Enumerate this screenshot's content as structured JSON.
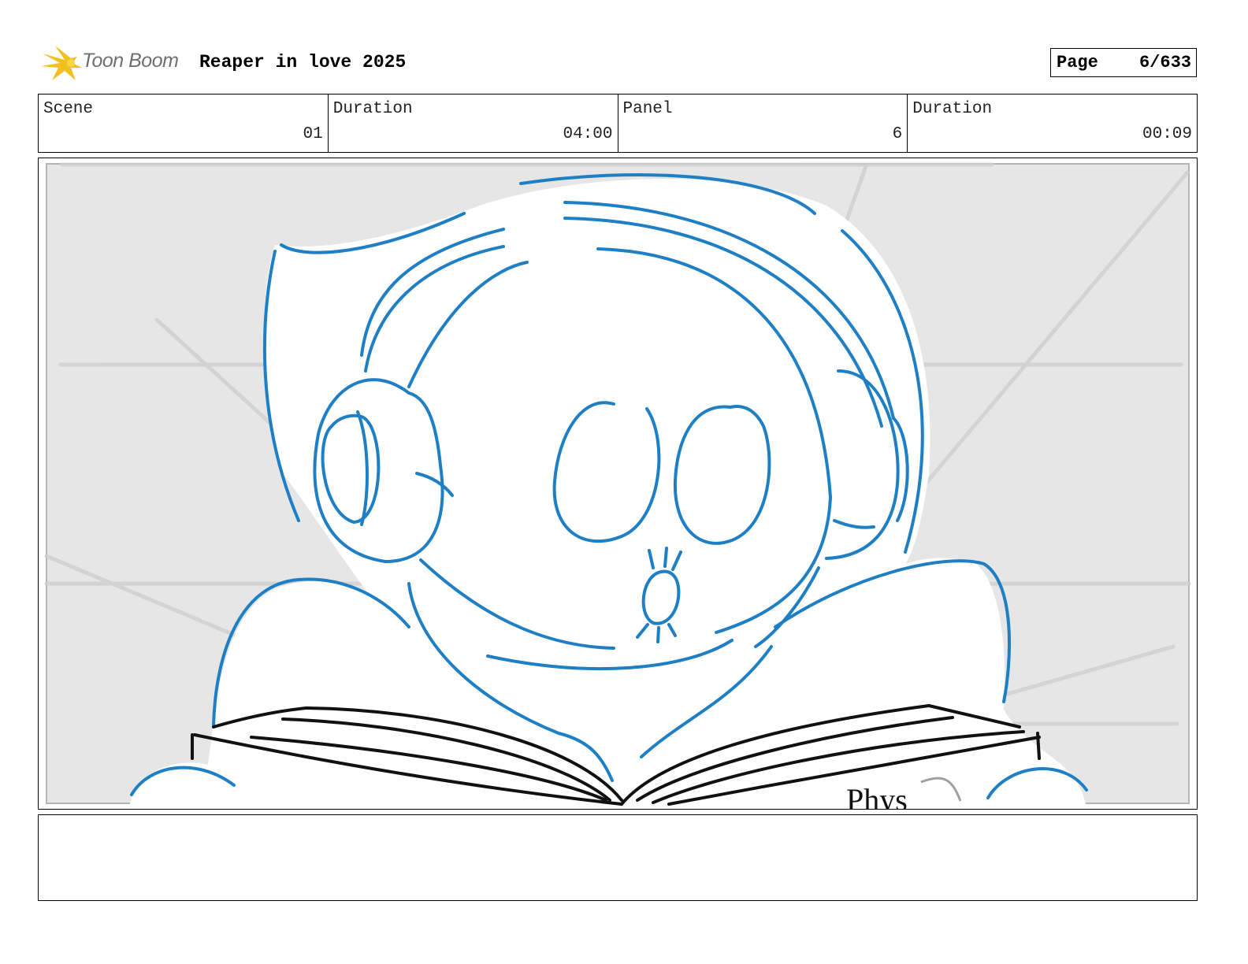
{
  "header": {
    "logo_text": "Toon Boom",
    "project_title": "Reaper in love 2025",
    "page_label": "Page",
    "page_value": "6/633"
  },
  "info": {
    "scene_label": "Scene",
    "scene_value": "01",
    "scene_duration_label": "Duration",
    "scene_duration_value": "04:00",
    "panel_label": "Panel",
    "panel_value": "6",
    "panel_duration_label": "Duration",
    "panel_duration_value": "00:09"
  },
  "panel": {
    "book_text": "Phys"
  },
  "colors": {
    "sketch_blue": "#1f7fc4",
    "background_gray": "#e6e6e6",
    "logo_yellow": "#f2c01e"
  }
}
